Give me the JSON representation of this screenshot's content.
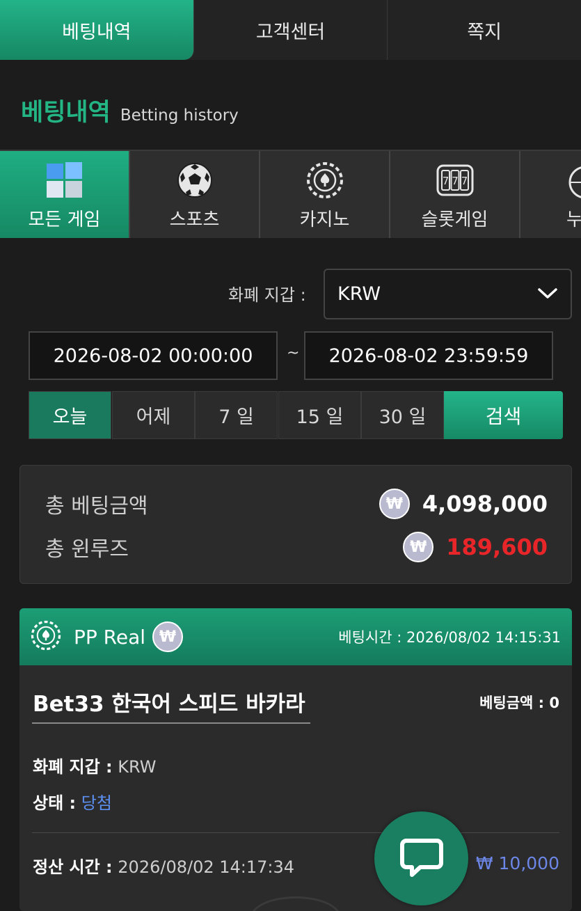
{
  "top_tabs": [
    {
      "label": "베팅내역"
    },
    {
      "label": "고객센터"
    },
    {
      "label": "쪽지"
    }
  ],
  "heading": {
    "title": "베팅내역",
    "subtitle": "Betting history"
  },
  "categories": [
    {
      "label": "모든 게임",
      "icon": "all-games-icon"
    },
    {
      "label": "스포츠",
      "icon": "soccer-ball-icon"
    },
    {
      "label": "카지노",
      "icon": "casino-chip-icon"
    },
    {
      "label": "슬롯게임",
      "icon": "slot-machine-icon"
    },
    {
      "label": "누",
      "icon": "more-icon"
    }
  ],
  "filters": {
    "currency_label": "화폐 지갑 :",
    "currency_value": "KRW",
    "date_from": "2026-08-02 00:00:00",
    "date_separator": "~",
    "date_to": "2026-08-02 23:59:59",
    "periods": [
      "오늘",
      "어제",
      "7 일",
      "15 일",
      "30 일"
    ],
    "search_label": "검색"
  },
  "summary": {
    "total_bet_label": "총 베팅금액",
    "total_bet_value": "4,098,000",
    "total_winloss_label": "총 윈루즈",
    "total_winloss_value": "189,600",
    "currency_symbol": "₩",
    "winloss_color": "#e8262a"
  },
  "bet_card": {
    "provider": "PP Real",
    "currency_symbol": "₩",
    "bet_time_label": "베팅시간 :",
    "bet_time": "2026/08/02 14:15:31",
    "game_title": "Bet33 한국어 스피드 바카라",
    "bet_amount_label": "베팅금액 :",
    "bet_amount": "0",
    "wallet_label": "화폐 지갑 :",
    "wallet_value": "KRW",
    "status_label": "상태 :",
    "status_value": "당첨",
    "settle_label": "정산 시간 :",
    "settle_time": "2026/08/02 14:17:34",
    "payout": "₩ 10,000"
  },
  "colors": {
    "accent": "#1fae82",
    "status_win": "#5b8ff0"
  }
}
